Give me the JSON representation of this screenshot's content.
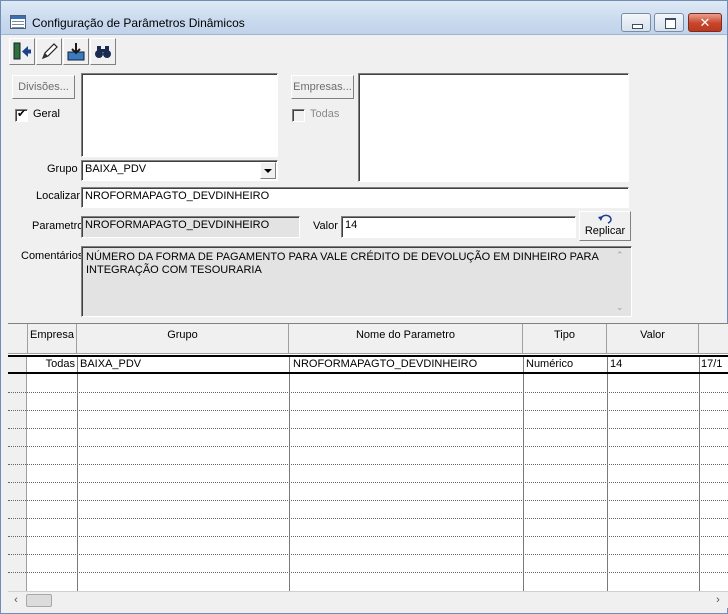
{
  "window": {
    "title": "Configuração de Parâmetros Dinâmicos",
    "close_glyph": "✕"
  },
  "toolbar": {
    "buttons": [
      {
        "icon": "exit-door-icon"
      },
      {
        "icon": "pencil-icon"
      },
      {
        "icon": "save-disk-icon"
      },
      {
        "icon": "binoculars-icon"
      }
    ]
  },
  "form": {
    "divisoes_label": "Divisões...",
    "geral_label": "Geral",
    "geral_checked": true,
    "empresas_label": "Empresas...",
    "todas_label": "Todas",
    "todas_checked": false,
    "grupo_label": "Grupo",
    "grupo_value": "BAIXA_PDV",
    "localizar_label": "Localizar",
    "localizar_value": "NROFORMAPAGTO_DEVDINHEIRO",
    "parametro_label": "Parametro",
    "parametro_value": "NROFORMAPAGTO_DEVDINHEIRO",
    "valor_label": "Valor",
    "valor_value": "14",
    "replicar_label": "Replicar",
    "comentarios_label": "Comentários",
    "comentarios_value": "NÚMERO DA FORMA DE PAGAMENTO PARA VALE CRÉDITO DE DEVOLUÇÃO EM DINHEIRO PARA INTEGRAÇÃO COM TESOURARIA"
  },
  "grid": {
    "headers": [
      "Empresa",
      "Grupo",
      "Nome do Parametro",
      "Tipo",
      "Valor"
    ],
    "rows": [
      {
        "empresa": "Todas",
        "grupo": "BAIXA_PDV",
        "nome": "NROFORMAPAGTO_DEVDINHEIRO",
        "tipo": "Numérico",
        "valor": "14",
        "extra": "17/1"
      }
    ]
  },
  "colors": {
    "window_bg": "#f0f0f0",
    "title_gradient": "#c9d9ee",
    "close_button": "#c8452b"
  }
}
